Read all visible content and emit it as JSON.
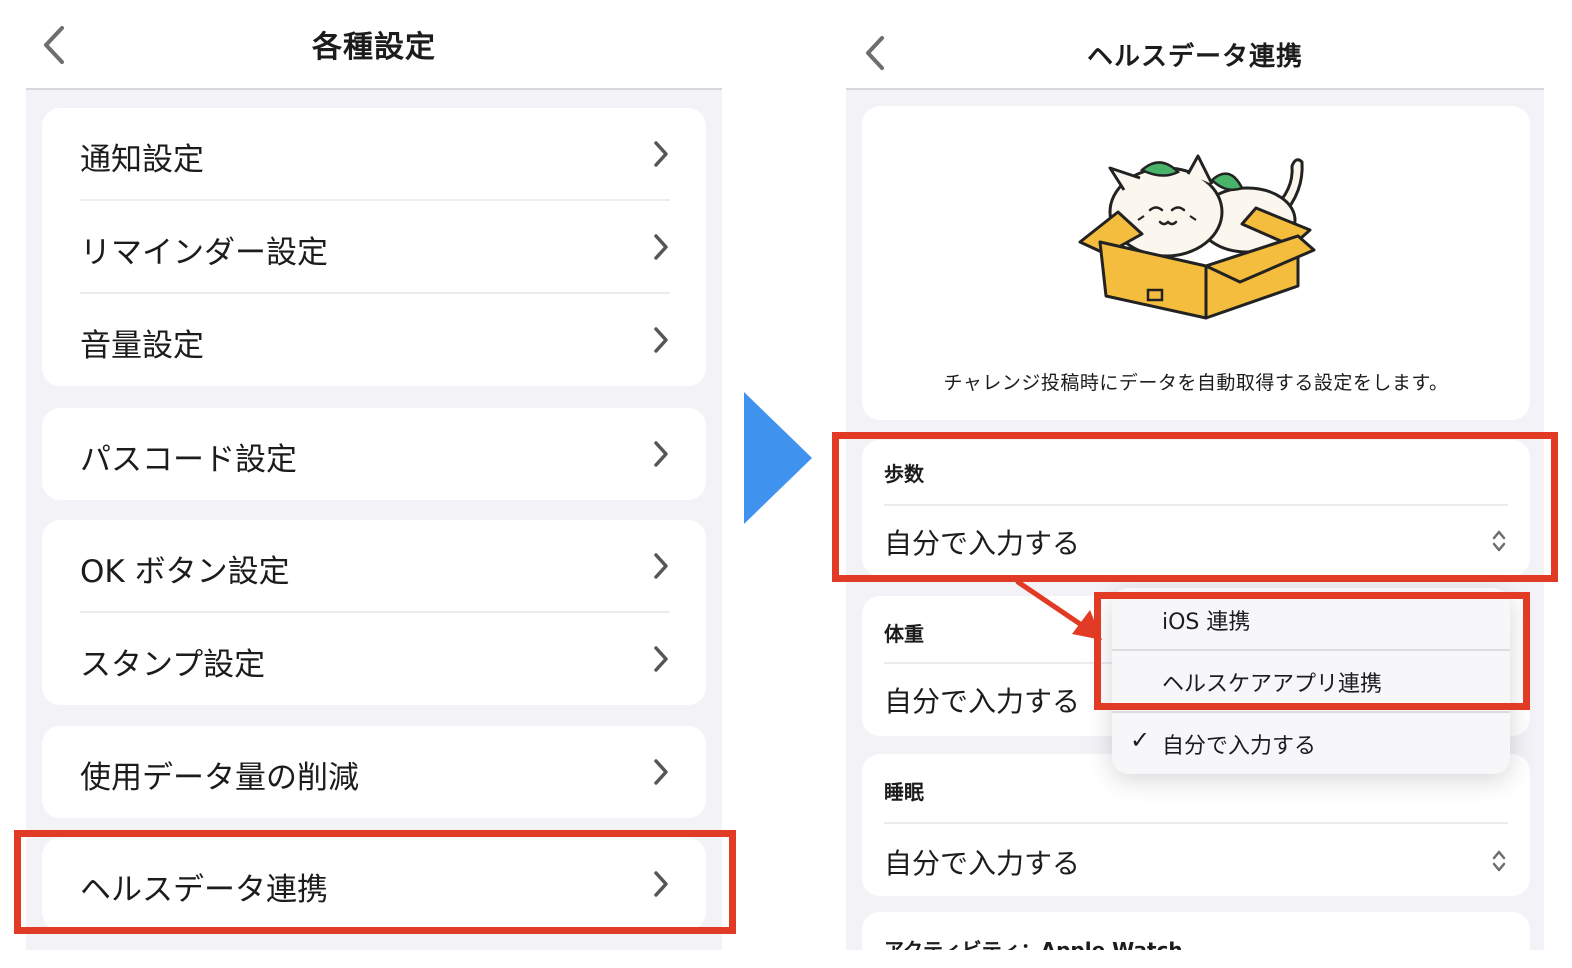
{
  "left_screen": {
    "title": "各種設定",
    "groups": [
      [
        "通知設定",
        "リマインダー設定",
        "音量設定"
      ],
      [
        "パスコード設定"
      ],
      [
        "OK ボタン設定",
        "スタンプ設定"
      ],
      [
        "使用データ量の削減"
      ],
      [
        "ヘルスデータ連携"
      ]
    ]
  },
  "right_screen": {
    "title": "ヘルスデータ連携",
    "description": "チャレンジ投稿時にデータを自動取得する設定をします。",
    "sections": [
      {
        "title": "歩数",
        "value": "自分で入力する"
      },
      {
        "title": "体重",
        "value": "自分で入力する"
      },
      {
        "title": "睡眠",
        "value": "自分で入力する"
      },
      {
        "title": "アクティビティ：Apple Watch"
      }
    ],
    "dropdown": {
      "options": [
        "iOS 連携",
        "ヘルスケアアプリ連携",
        "自分で入力する"
      ],
      "selected": "自分で入力する",
      "check": "✓"
    }
  },
  "colors": {
    "highlight": "#e23b25",
    "arrow": "#3f93ef",
    "box": "#f4bd3e"
  },
  "icons": [
    "back-chevron-icon",
    "chevron-right-icon",
    "up-down-chevron-icon",
    "checkmark-icon",
    "cat-in-box-illustration",
    "next-arrow-icon"
  ]
}
